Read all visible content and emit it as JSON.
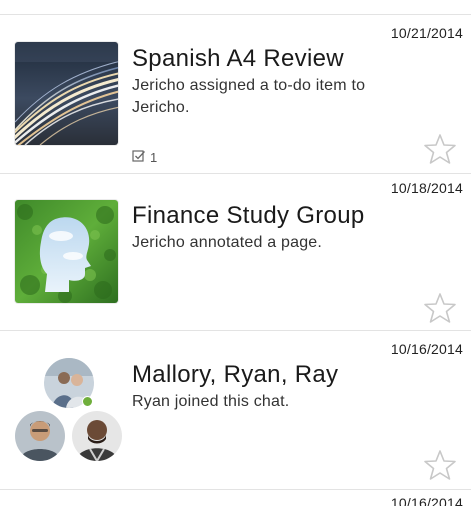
{
  "conversations": [
    {
      "title": "Spanish A4 Review",
      "subtitle": "Jericho assigned a to-do item to Jericho.",
      "date": "10/21/2014",
      "todo_count": "1",
      "thumbnail": "light-trails-image",
      "starred": false
    },
    {
      "title": "Finance Study Group",
      "subtitle": "Jericho annotated a page.",
      "date": "10/18/2014",
      "thumbnail": "leaf-head-silhouette-image",
      "starred": false
    },
    {
      "title": "Mallory, Ryan, Ray",
      "subtitle": "Ryan joined this chat.",
      "date": "10/16/2014",
      "thumbnail": "group-avatars",
      "online_indicator_color": "#6fae3c",
      "starred": false
    },
    {
      "date": "10/16/2014"
    }
  ],
  "colors": {
    "divider": "#e3e3e3",
    "star_outline": "#c8c8c8",
    "online": "#6fae3c"
  }
}
